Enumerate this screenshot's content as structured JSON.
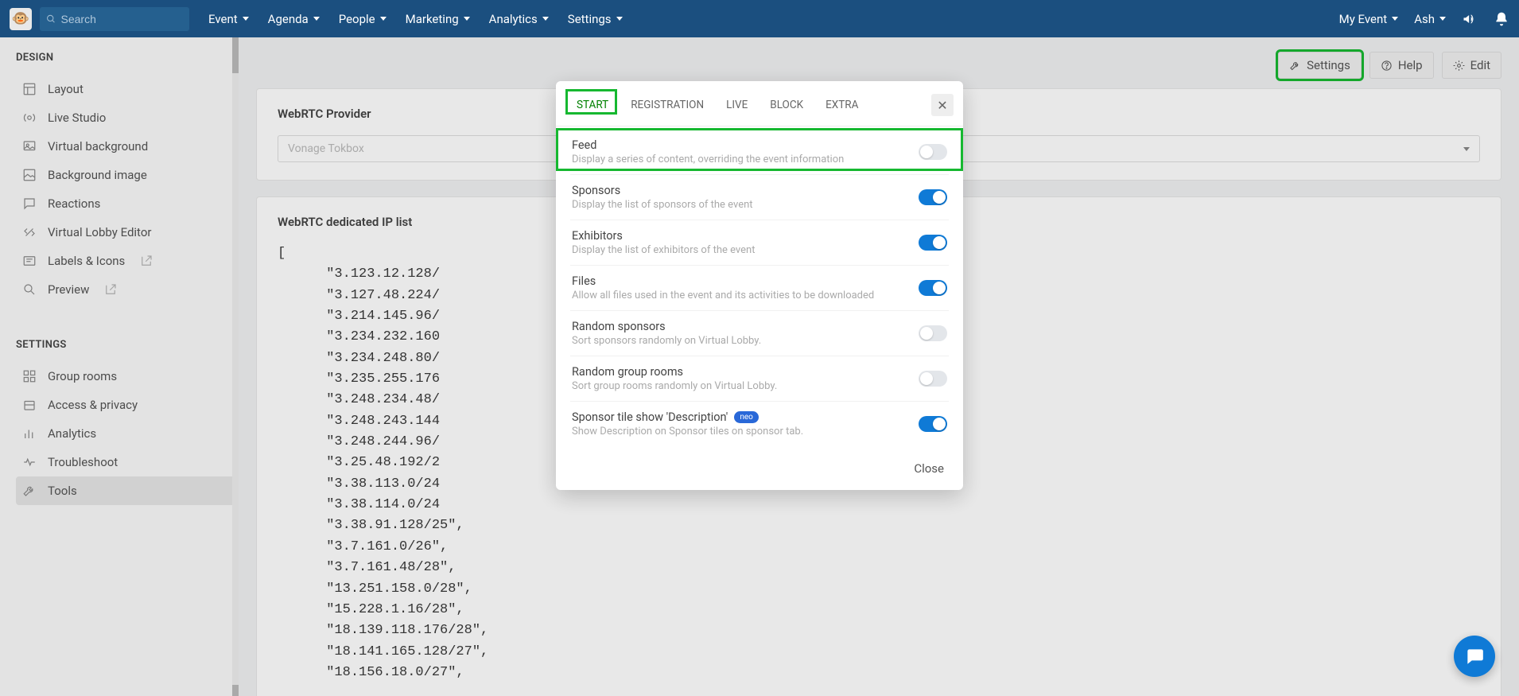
{
  "topnav": {
    "search_placeholder": "Search",
    "items": [
      "Event",
      "Agenda",
      "People",
      "Marketing",
      "Analytics",
      "Settings"
    ],
    "my_event": "My Event",
    "user": "Ash"
  },
  "actions": {
    "settings": "Settings",
    "help": "Help",
    "edit": "Edit"
  },
  "sidebar": {
    "section_design": "DESIGN",
    "design_items": [
      {
        "label": "Layout"
      },
      {
        "label": "Live Studio"
      },
      {
        "label": "Virtual background"
      },
      {
        "label": "Background image"
      },
      {
        "label": "Reactions"
      },
      {
        "label": "Virtual Lobby Editor"
      },
      {
        "label": "Labels & Icons",
        "ext": true
      },
      {
        "label": "Preview",
        "ext": true
      }
    ],
    "section_settings": "SETTINGS",
    "settings_items": [
      {
        "label": "Group rooms"
      },
      {
        "label": "Access & privacy"
      },
      {
        "label": "Analytics"
      },
      {
        "label": "Troubleshoot"
      },
      {
        "label": "Tools",
        "active": true
      }
    ]
  },
  "main": {
    "provider_label": "WebRTC Provider",
    "provider_value": "Vonage Tokbox",
    "ip_label": "WebRTC dedicated IP list",
    "ip_list": "[\n      \"3.123.12.128/\n      \"3.127.48.224/\n      \"3.214.145.96/\n      \"3.234.232.160\n      \"3.234.248.80/\n      \"3.235.255.176\n      \"3.248.234.48/\n      \"3.248.243.144\n      \"3.248.244.96/\n      \"3.25.48.192/2\n      \"3.38.113.0/24\n      \"3.38.114.0/24\n      \"3.38.91.128/25\",\n      \"3.7.161.0/26\",\n      \"3.7.161.48/28\",\n      \"13.251.158.0/28\",\n      \"15.228.1.16/28\",\n      \"18.139.118.176/28\",\n      \"18.141.165.128/27\",\n      \"18.156.18.0/27\","
  },
  "modal": {
    "tabs": [
      "START",
      "REGISTRATION",
      "LIVE",
      "BLOCK",
      "EXTRA"
    ],
    "options": [
      {
        "title": "Feed",
        "desc": "Display a series of content, overriding the event information",
        "on": false
      },
      {
        "title": "Sponsors",
        "desc": "Display the list of sponsors of the event",
        "on": true
      },
      {
        "title": "Exhibitors",
        "desc": "Display the list of exhibitors of the event",
        "on": true
      },
      {
        "title": "Files",
        "desc": "Allow all files used in the event and its activities to be downloaded",
        "on": true
      },
      {
        "title": "Random sponsors",
        "desc": "Sort sponsors randomly on Virtual Lobby.",
        "on": false
      },
      {
        "title": "Random group rooms",
        "desc": "Sort group rooms randomly on Virtual Lobby.",
        "on": false
      },
      {
        "title": "Sponsor tile show 'Description'",
        "desc": "Show Description on Sponsor tiles on sponsor tab.",
        "on": true,
        "neo": true
      }
    ],
    "neo_label": "neo",
    "close": "Close"
  }
}
